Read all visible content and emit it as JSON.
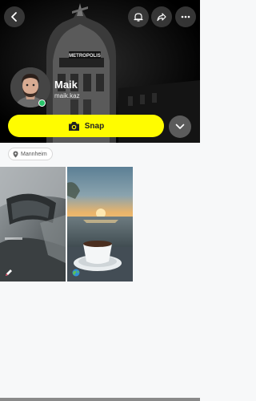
{
  "profile": {
    "display_name": "Maik",
    "username": "maik.kaz",
    "hero_sign": "METROPOLIS"
  },
  "header": {
    "back_icon": "chevron-left-icon",
    "notification_icon": "bell-icon",
    "share_icon": "share-arrow-icon",
    "more_icon": "ellipsis-icon"
  },
  "actions": {
    "snap_label": "Snap",
    "snap_icon": "camera-icon",
    "expand_icon": "chevron-down-icon"
  },
  "location": {
    "label": "Mannheim",
    "icon": "location-pin-icon"
  },
  "tiles": [
    {
      "kind": "car interior",
      "badge_icon": "pencil-icon"
    },
    {
      "kind": "sunset coffee",
      "badge_icon": "globe-icon"
    }
  ],
  "colors": {
    "snap_yellow": "#fffc00",
    "online_green": "#29c46a",
    "page_bg": "#f7f8f9"
  }
}
